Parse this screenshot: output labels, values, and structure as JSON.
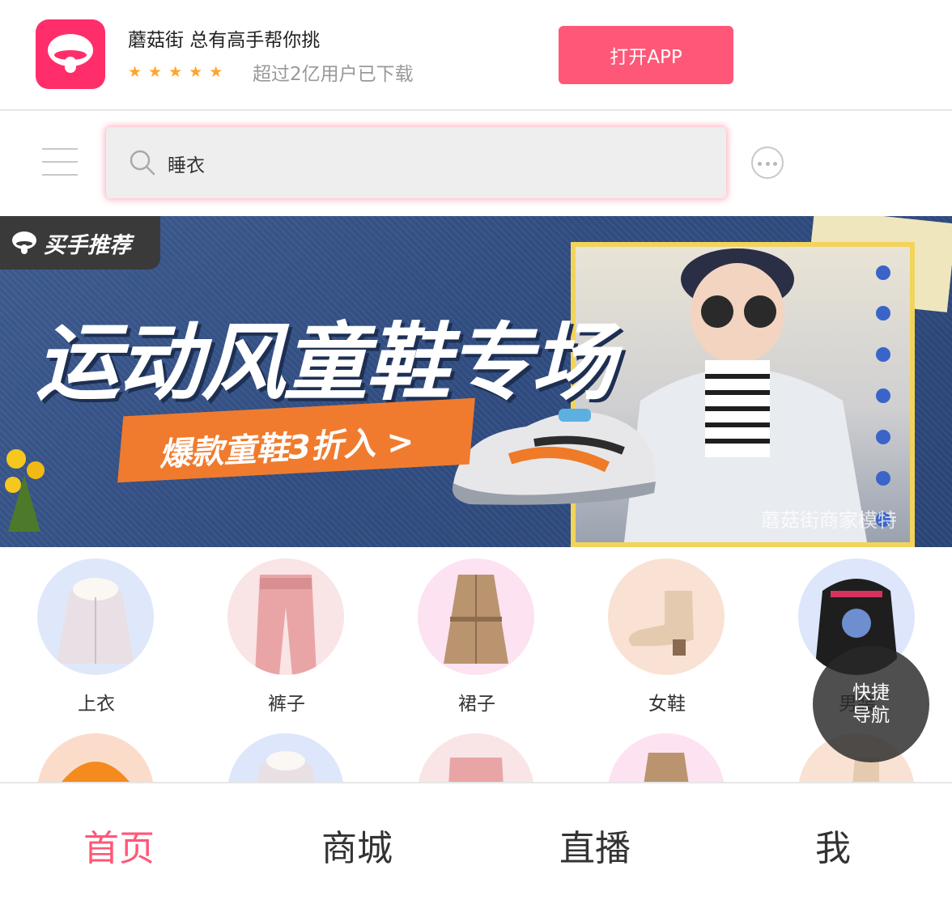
{
  "app_banner": {
    "title": "蘑菇街 总有高手帮你挑",
    "stars": [
      "★",
      "★",
      "★",
      "★",
      "★"
    ],
    "subtitle": "超过2亿用户已下载",
    "open_button": "打开APP"
  },
  "search": {
    "value": "睡衣"
  },
  "hero": {
    "tag": "买手推荐",
    "title": "运动风童鞋专场",
    "cta": "爆款童鞋3折入 >",
    "watermark": "蘑菇街商家模特"
  },
  "categories": [
    {
      "label": "上衣",
      "color": "#dfe8fb"
    },
    {
      "label": "裤子",
      "color": "#f9e4e6"
    },
    {
      "label": "裙子",
      "color": "#fde2f1"
    },
    {
      "label": "女鞋",
      "color": "#f9e2d3"
    },
    {
      "label": "男装",
      "color": "#dde6fa"
    }
  ],
  "categories_row2": [
    {
      "color": "#fbdccb"
    },
    {
      "color": "#dde6fa"
    },
    {
      "color": "#f9e4e6"
    },
    {
      "color": "#fde2f1"
    },
    {
      "color": "#f9e2d3"
    }
  ],
  "quick_nav": {
    "line1": "快捷",
    "line2": "导航"
  },
  "tabbar": {
    "items": [
      {
        "label": "首页",
        "active": true
      },
      {
        "label": "商城",
        "active": false
      },
      {
        "label": "直播",
        "active": false
      },
      {
        "label": "我",
        "active": false
      }
    ]
  },
  "colors": {
    "brand": "#ff5777",
    "star": "#ffa52d"
  }
}
